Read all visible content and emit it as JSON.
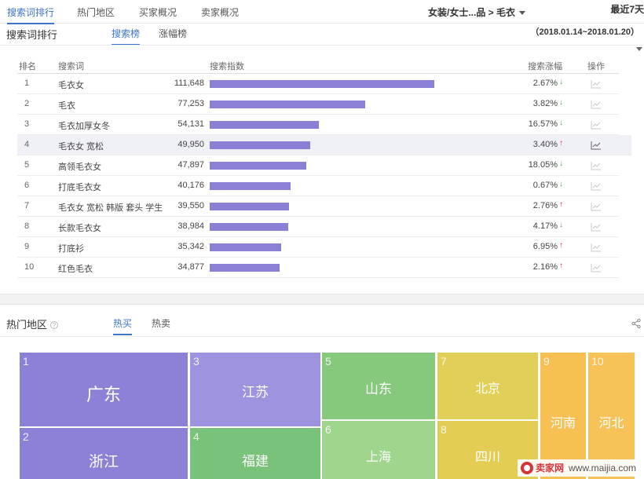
{
  "topnav": {
    "tabs": [
      "搜索词排行",
      "热门地区",
      "买家概况",
      "卖家概况"
    ],
    "category": "女装/女士...品 > 毛衣",
    "period": "最近7天"
  },
  "search_ranking": {
    "title": "搜索词排行",
    "subtabs": [
      "搜索榜",
      "涨幅榜"
    ],
    "date_range": "（2018.01.14~2018.01.20）",
    "columns": {
      "rank": "排名",
      "keyword": "搜索词",
      "index": "搜索指数",
      "change": "搜索涨幅",
      "action": "操作"
    },
    "rows": [
      {
        "rank": "1",
        "keyword": "毛衣女",
        "value": "111,648",
        "index": 111648,
        "change": "2.67%",
        "dir": "down"
      },
      {
        "rank": "2",
        "keyword": "毛衣",
        "value": "77,253",
        "index": 77253,
        "change": "3.82%",
        "dir": "down"
      },
      {
        "rank": "3",
        "keyword": "毛衣加厚女冬",
        "value": "54,131",
        "index": 54131,
        "change": "16.57%",
        "dir": "down"
      },
      {
        "rank": "4",
        "keyword": "毛衣女 宽松",
        "value": "49,950",
        "index": 49950,
        "change": "3.40%",
        "dir": "up"
      },
      {
        "rank": "5",
        "keyword": "高领毛衣女",
        "value": "47,897",
        "index": 47897,
        "change": "18.05%",
        "dir": "down"
      },
      {
        "rank": "6",
        "keyword": "打底毛衣女",
        "value": "40,176",
        "index": 40176,
        "change": "0.67%",
        "dir": "down"
      },
      {
        "rank": "7",
        "keyword": "毛衣女 宽松 韩版 套头 学生",
        "value": "39,550",
        "index": 39550,
        "change": "2.76%",
        "dir": "up"
      },
      {
        "rank": "8",
        "keyword": "长款毛衣女",
        "value": "38,984",
        "index": 38984,
        "change": "4.17%",
        "dir": "down"
      },
      {
        "rank": "9",
        "keyword": "打底衫",
        "value": "35,342",
        "index": 35342,
        "change": "6.95%",
        "dir": "up"
      },
      {
        "rank": "10",
        "keyword": "红色毛衣",
        "value": "34,877",
        "index": 34877,
        "change": "2.16%",
        "dir": "up"
      }
    ],
    "highlighted_rank": "4",
    "colors": {
      "bar": "#8a80d6",
      "up": "#d4343a",
      "down": "#4caa46",
      "accent": "#3b74c9"
    }
  },
  "hot_regions": {
    "title": "热门地区",
    "subtabs": [
      "热买",
      "热卖"
    ],
    "cells": [
      {
        "num": "1",
        "name": "广东",
        "color": "#8b82d8"
      },
      {
        "num": "2",
        "name": "浙江",
        "color": "#8b82d8"
      },
      {
        "num": "3",
        "name": "江苏",
        "color": "#9d94e0"
      },
      {
        "num": "4",
        "name": "福建",
        "color": "#79c27a"
      },
      {
        "num": "5",
        "name": "山东",
        "color": "#86c97d"
      },
      {
        "num": "6",
        "name": "上海",
        "color": "#9fd58c"
      },
      {
        "num": "7",
        "name": "北京",
        "color": "#e2cf58"
      },
      {
        "num": "8",
        "name": "四川",
        "color": "#e3cd55"
      },
      {
        "num": "9",
        "name": "河南",
        "color": "#f6c052"
      },
      {
        "num": "10",
        "name": "河北",
        "color": "#f7c257"
      }
    ]
  },
  "watermark": {
    "brand": "卖家网",
    "url": "www.maijia.com"
  }
}
